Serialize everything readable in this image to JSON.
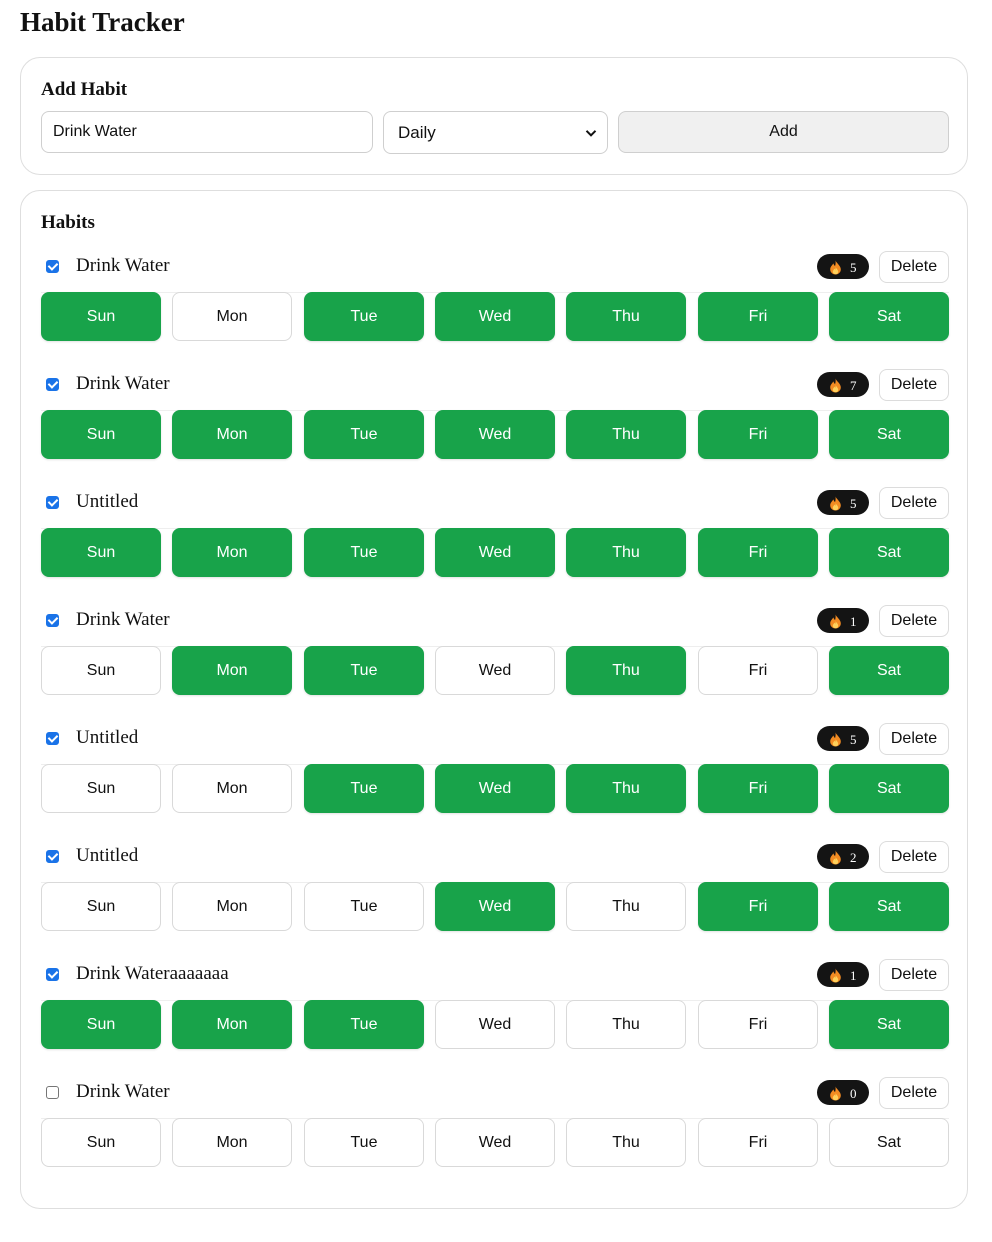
{
  "app": {
    "title": "Habit Tracker"
  },
  "add_habit": {
    "heading": "Add Habit",
    "name_value": "Drink Water",
    "name_placeholder": "",
    "frequency_selected": "Daily",
    "add_label": "Add"
  },
  "habits_section": {
    "heading": "Habits"
  },
  "delete_label": "Delete",
  "colors": {
    "done_green": "#18a34a",
    "streak_badge": "#141414",
    "checkbox_blue": "#1a73e8",
    "flame": "#f28b22"
  },
  "day_labels": [
    "Sun",
    "Mon",
    "Tue",
    "Wed",
    "Thu",
    "Fri",
    "Sat"
  ],
  "habits": [
    {
      "name": "Drink Water",
      "checked": true,
      "streak": "5",
      "days": [
        true,
        false,
        true,
        true,
        true,
        true,
        true
      ]
    },
    {
      "name": "Drink Water",
      "checked": true,
      "streak": "7",
      "days": [
        true,
        true,
        true,
        true,
        true,
        true,
        true
      ]
    },
    {
      "name": "Untitled",
      "checked": true,
      "streak": "5",
      "days": [
        true,
        true,
        true,
        true,
        true,
        true,
        true
      ]
    },
    {
      "name": "Drink Water",
      "checked": true,
      "streak": "1",
      "days": [
        false,
        true,
        true,
        false,
        true,
        false,
        true
      ]
    },
    {
      "name": "Untitled",
      "checked": true,
      "streak": "5",
      "days": [
        false,
        false,
        true,
        true,
        true,
        true,
        true
      ]
    },
    {
      "name": "Untitled",
      "checked": true,
      "streak": "2",
      "days": [
        false,
        false,
        false,
        true,
        false,
        true,
        true
      ]
    },
    {
      "name": "Drink Wateraaaaaaa",
      "checked": true,
      "streak": "1",
      "days": [
        true,
        true,
        true,
        false,
        false,
        false,
        true
      ]
    },
    {
      "name": "Drink Water",
      "checked": false,
      "streak": "0",
      "days": [
        false,
        false,
        false,
        false,
        false,
        false,
        false
      ]
    }
  ]
}
